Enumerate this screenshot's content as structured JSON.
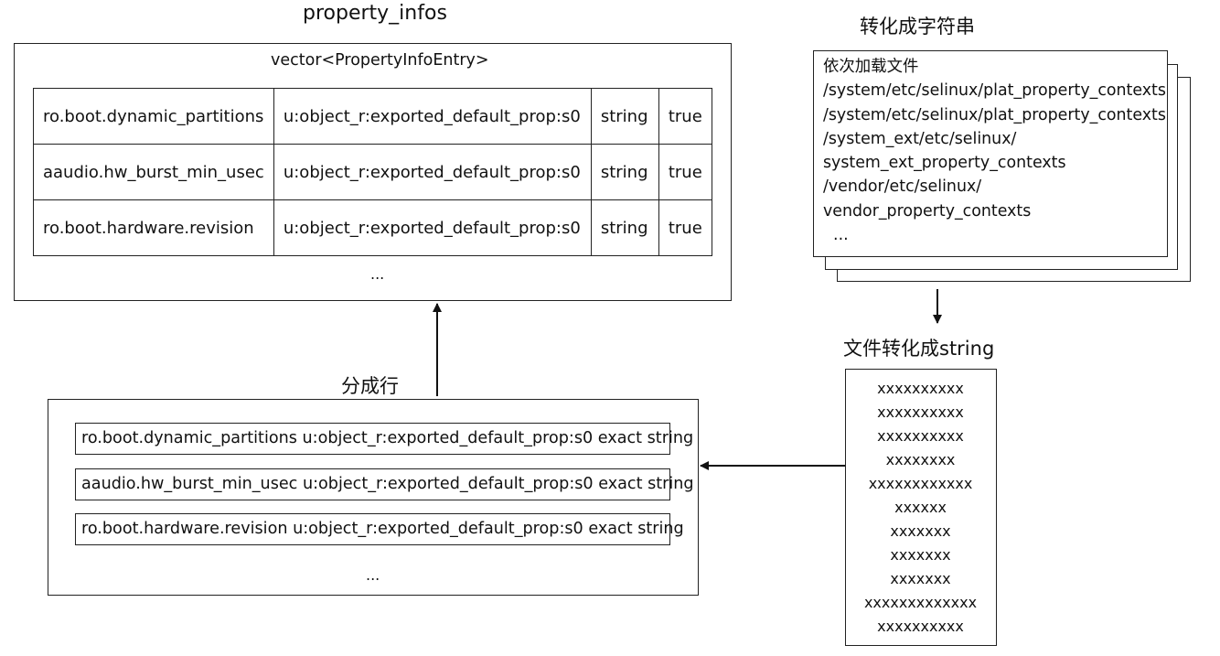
{
  "property_infos": {
    "title": "property_infos",
    "caption": "vector<PropertyInfoEntry>",
    "rows": [
      [
        "ro.boot.dynamic_partitions",
        "u:object_r:exported_default_prop:s0",
        "string",
        "true"
      ],
      [
        "aaudio.hw_burst_min_usec",
        "u:object_r:exported_default_prop:s0",
        "string",
        "true"
      ],
      [
        "ro.boot.hardware.revision",
        "u:object_r:exported_default_prop:s0",
        "string",
        "true"
      ]
    ],
    "ellipsis": "..."
  },
  "files": {
    "title": "转化成字符串",
    "lines": [
      "依次加载文件",
      "/system/etc/selinux/plat_property_contexts",
      "/system/etc/selinux/plat_property_contexts",
      "/system_ext/etc/selinux/",
      "system_ext_property_contexts",
      "/vendor/etc/selinux/",
      "vendor_property_contexts",
      "  ..."
    ]
  },
  "string_block": {
    "title": "文件转化成string",
    "lines": [
      "xxxxxxxxxx",
      "xxxxxxxxxx",
      "xxxxxxxxxx",
      "xxxxxxxx",
      "xxxxxxxxxxxx",
      "xxxxxx",
      "xxxxxxx",
      "xxxxxxx",
      "xxxxxxx",
      "xxxxxxxxxxxxx",
      "xxxxxxxxxx"
    ]
  },
  "split_lines": {
    "title": "分成行",
    "lines": [
      "ro.boot.dynamic_partitions u:object_r:exported_default_prop:s0 exact string",
      "aaudio.hw_burst_min_usec u:object_r:exported_default_prop:s0 exact string",
      "ro.boot.hardware.revision u:object_r:exported_default_prop:s0 exact string"
    ],
    "ellipsis": "..."
  }
}
